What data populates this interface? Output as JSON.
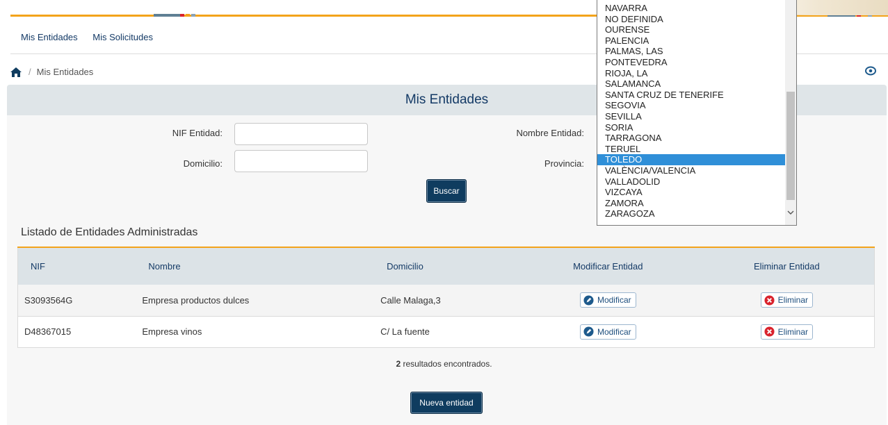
{
  "nav": {
    "items": [
      "Mis Entidades",
      "Mis Solicitudes"
    ]
  },
  "breadcrumb": {
    "current": "Mis Entidades",
    "separator": "/"
  },
  "panel": {
    "title": "Mis Entidades"
  },
  "form": {
    "nif_label": "NIF Entidad:",
    "nombre_label": "Nombre Entidad:",
    "domicilio_label": "Domicilio:",
    "provincia_label": "Provincia:",
    "nif_value": "",
    "domicilio_value": "",
    "buscar": "Buscar"
  },
  "list_title": "Listado de Entidades Administradas",
  "table": {
    "headers": [
      "NIF",
      "Nombre",
      "Domicilio",
      "Modificar Entidad",
      "Eliminar Entidad"
    ],
    "rows": [
      {
        "nif": "S3093564G",
        "nombre": "Empresa productos dulces",
        "domicilio": "Calle Malaga,3",
        "modificar": "Modificar",
        "eliminar": "Eliminar"
      },
      {
        "nif": "D48367015",
        "nombre": "Empresa vinos",
        "domicilio": "C/ La fuente",
        "modificar": "Modificar",
        "eliminar": "Eliminar"
      }
    ]
  },
  "results": {
    "count": "2",
    "text": " resultados encontrados."
  },
  "nueva": "Nueva entidad",
  "provincia_dropdown": {
    "options": [
      "NAVARRA",
      "NO DEFINIDA",
      "OURENSE",
      "PALENCIA",
      "PALMAS, LAS",
      "PONTEVEDRA",
      "RIOJA, LA",
      "SALAMANCA",
      "SANTA CRUZ DE TENERIFE",
      "SEGOVIA",
      "SEVILLA",
      "SORIA",
      "TARRAGONA",
      "TERUEL",
      "TOLEDO",
      "VALÈNCIA/VALENCIA",
      "VALLADOLID",
      "VIZCAYA",
      "ZAMORA",
      "ZARAGOZA"
    ],
    "selected": "TOLEDO"
  },
  "colors": {
    "accent": "#f3a31a",
    "brand": "#143a66",
    "button": "#0f3c5f",
    "selection": "#2f8fd8",
    "danger": "#d9232d"
  }
}
